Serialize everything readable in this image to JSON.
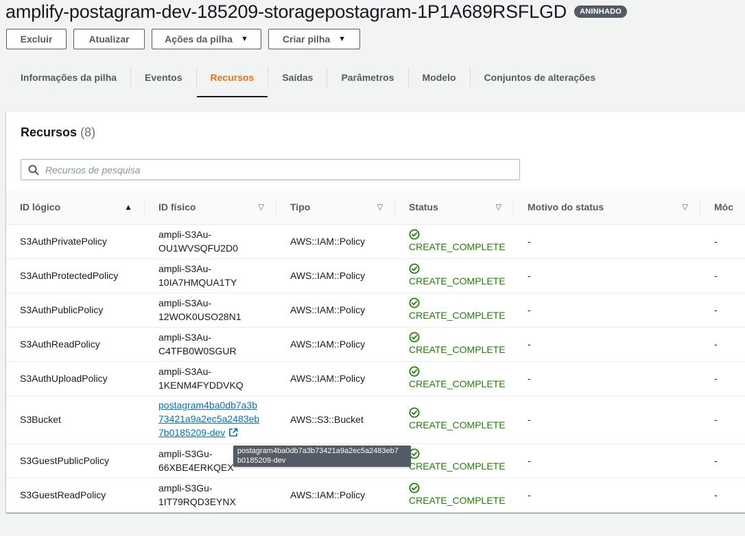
{
  "header": {
    "stack_name": "amplify-postagram-dev-185209-storagepostagram-1P1A689RSFLGD",
    "badge": "ANINHADO"
  },
  "toolbar": {
    "delete_label": "Excluir",
    "refresh_label": "Atualizar",
    "stack_actions_label": "Ações da pilha",
    "create_stack_label": "Criar pilha"
  },
  "tabs": [
    {
      "label": "Informações da pilha"
    },
    {
      "label": "Eventos"
    },
    {
      "label": "Recursos",
      "active": true
    },
    {
      "label": "Saídas"
    },
    {
      "label": "Parâmetros"
    },
    {
      "label": "Modelo"
    },
    {
      "label": "Conjuntos de alterações"
    }
  ],
  "resources": {
    "title": "Recursos",
    "count": "(8)",
    "search_placeholder": "Recursos de pesquisa",
    "columns": [
      "ID lógico",
      "ID físico",
      "Tipo",
      "Status",
      "Motivo do status",
      "Móc"
    ],
    "rows": [
      {
        "logical_id": "S3AuthPrivatePolicy",
        "physical_id": "ampli-S3Au-OU1WVSQFU2D0",
        "physical_id_line1": "ampli-S3Au-",
        "physical_id_line2": "OU1WVSQFU2D0",
        "type": "AWS::IAM::Policy",
        "status": "CREATE_COMPLETE",
        "reason": "-",
        "module": "-"
      },
      {
        "logical_id": "S3AuthProtectedPolicy",
        "physical_id": "ampli-S3Au-10IA7HMQUA1TY",
        "physical_id_line1": "ampli-S3Au-",
        "physical_id_line2": "10IA7HMQUA1TY",
        "type": "AWS::IAM::Policy",
        "status": "CREATE_COMPLETE",
        "reason": "-",
        "module": "-"
      },
      {
        "logical_id": "S3AuthPublicPolicy",
        "physical_id": "ampli-S3Au-12WOK0USO28N1",
        "physical_id_line1": "ampli-S3Au-",
        "physical_id_line2": "12WOK0USO28N1",
        "type": "AWS::IAM::Policy",
        "status": "CREATE_COMPLETE",
        "reason": "-",
        "module": "-"
      },
      {
        "logical_id": "S3AuthReadPolicy",
        "physical_id": "ampli-S3Au-C4TFB0W0SGUR",
        "physical_id_line1": "ampli-S3Au-",
        "physical_id_line2": "C4TFB0W0SGUR",
        "type": "AWS::IAM::Policy",
        "status": "CREATE_COMPLETE",
        "reason": "-",
        "module": "-"
      },
      {
        "logical_id": "S3AuthUploadPolicy",
        "physical_id": "ampli-S3Au-1KENM4FYDDVKQ",
        "physical_id_line1": "ampli-S3Au-",
        "physical_id_line2": "1KENM4FYDDVKQ",
        "type": "AWS::IAM::Policy",
        "status": "CREATE_COMPLETE",
        "reason": "-",
        "module": "-"
      },
      {
        "logical_id": "S3Bucket",
        "physical_id": "postagram4ba0db7a3b73421a9a2ec5a2483eb7b0185209-dev",
        "physical_id_line1": "postagram4ba0db7a3b",
        "physical_id_line2": "73421a9a2ec5a2483eb",
        "physical_id_line3": "7b0185209-dev",
        "type": "AWS::S3::Bucket",
        "status": "CREATE_COMPLETE",
        "reason": "-",
        "module": "-",
        "is_link": true
      },
      {
        "logical_id": "S3GuestPublicPolicy",
        "physical_id": "ampli-S3Gu-66XBE4ERKQEX",
        "physical_id_line1": "ampli-S3Gu-",
        "physical_id_line2": "66XBE4ERKQEX",
        "type": "AWS::IAM::Policy",
        "status": "CREATE_COMPLETE",
        "reason": "-",
        "module": "-"
      },
      {
        "logical_id": "S3GuestReadPolicy",
        "physical_id": "ampli-S3Gu-1IT79RQD3EYNX",
        "physical_id_line1": "ampli-S3Gu-",
        "physical_id_line2": "1IT79RQD3EYNX",
        "type": "AWS::IAM::Policy",
        "status": "CREATE_COMPLETE",
        "reason": "-",
        "module": "-"
      }
    ]
  },
  "tooltip": {
    "line1": "postagram4ba0db7a3b73421a9a2ec5a2483eb7",
    "line2": "b0185209-dev"
  },
  "colors": {
    "accent_tab": "#ec7211",
    "status_success": "#1d8102",
    "link": "#0073bb",
    "badge_bg": "#545b64"
  }
}
